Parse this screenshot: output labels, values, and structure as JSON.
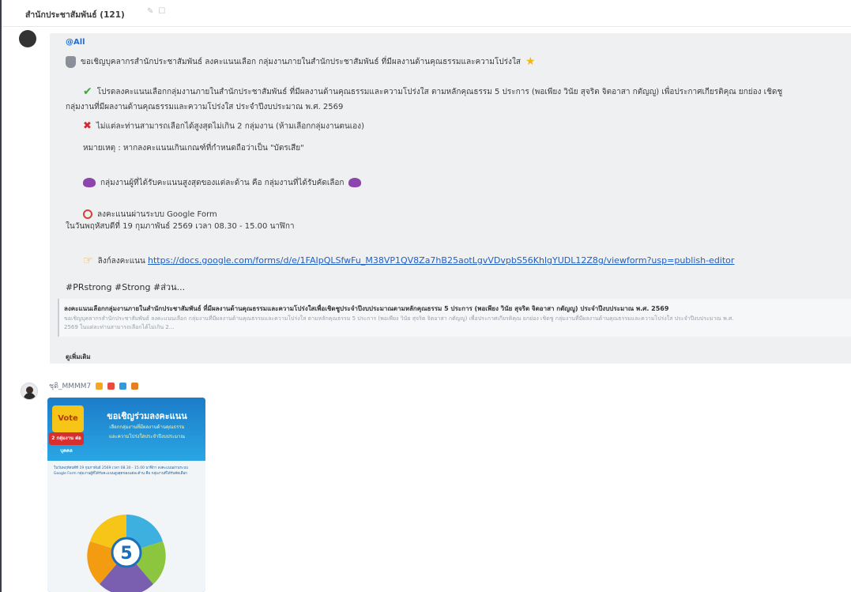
{
  "window": {
    "title": "สำนักประชาสัมพันธ์ (121)"
  },
  "message1": {
    "mention": "@All",
    "line1": "ขอเชิญบุคลากรสำนักประชาสัมพันธ์ ลงคะแนนเลือก กลุ่มงานภายในสำนักประชาสัมพันธ์ ที่มีผลงานด้านคุณธรรมและความโปร่งใส",
    "line2": "โปรดลงคะแนนเลือกกลุ่มงานภายในสำนักประชาสัมพันธ์ ที่มีผลงานด้านคุณธรรมและความโปร่งใส ตามหลักคุณธรรม 5 ประการ (พอเพียง วินัย สุจริต จิตอาสา กตัญญู) เพื่อประกาศเกียรติคุณ ยกย่อง เชิดชู",
    "line3": "กลุ่มงานที่มีผลงานด้านคุณธรรมและความโปร่งใส ประจำปีงบประมาณ พ.ศ. 2569",
    "line4": "ไม่แต่ละท่านสามารถเลือกได้สูงสุดไม่เกิน 2 กลุ่มงาน (ห้ามเลือกกลุ่มงานตนเอง)",
    "line5": "หมายเหตุ : หากลงคะแนนเกินเกณฑ์ที่กำหนดถือว่าเป็น \"บัตรเสีย\"",
    "line6": "กลุ่มงานผู้ที่ได้รับคะแนนสูงสุดของแต่ละด้าน คือ กลุ่มงานที่ได้รับคัดเลือก",
    "line7": "ลงคะแนนผ่านระบบ Google Form",
    "line8": "ในวันพฤหัสบดีที่ 19 กุมภาพันธ์ 2569 เวลา 08.30 - 15.00 นาฬิกา",
    "link_label": "ลิงก์ลงคะแนน",
    "link_url": "https://docs.google.com/forms/d/e/1FAIpQLSfwFu_M38VP1QV8Za7hB25aotLgvVDvpbS56KhlgYUDL12Z8g/viewform?usp=publish-editor",
    "hashtags": "#PRstrong #Strong #ส่วน...",
    "preview_title": "ลงคะแนนเลือกกลุ่มงานภายในสำนักประชาสัมพันธ์ ที่มีผลงานด้านคุณธรรมและความโปร่งใสเพื่อเชิดชูประจำปีงบประมาณตามหลักคุณธรรม 5 ประการ (พอเพียง วินัย สุจริต จิตอาสา กตัญญู) ประจำปีงบประมาณ พ.ศ. 2569",
    "preview_desc": "ขอเชิญบุคลากรสำนักประชาสัมพันธ์ ลงคะแนนเลือก กลุ่มงานที่มีผลงานด้านคุณธรรมและความโปร่งใส ตามหลักคุณธรรม 5 ประการ (พอเพียง วินัย สุจริต จิตอาสา กตัญญู) เพื่อประกาศเกียรติคุณ ยกย่อง เชิดชู กลุ่มงานที่มีผลงานด้านคุณธรรมและความโปร่งใส ประจำปีงบประมาณ พ.ศ.",
    "preview_desc2": "2569 ในแต่ละท่านสามารถเลือกได้ไม่เกิน 2...",
    "see_more": "ดูเพิ่มเติม"
  },
  "message2": {
    "sender": "ชุติ_MMMM7"
  },
  "poster": {
    "vote": "Vote",
    "badge": "2 กลุ่มงาน ต่อบุคคล",
    "heading": "ขอเชิญร่วมลงคะแนน",
    "sub1": "เลือกกลุ่มงานที่มีผลงานด้านคุณธรรม",
    "sub2": "และความโปร่งใสประจำปีงบประมาณ",
    "info": "ในวันพฤหัสบดีที่ 19 กุมภาพันธ์ 2569 เวลา 08.30 - 15.00 นาฬิกา ลงคะแนนผ่านระบบ Google Form กลุ่มงานผู้ที่ได้รับคะแนนสูงสุดของแต่ละด้าน คือ กลุ่มงานที่ได้รับคัดเลือก",
    "number": "5"
  }
}
